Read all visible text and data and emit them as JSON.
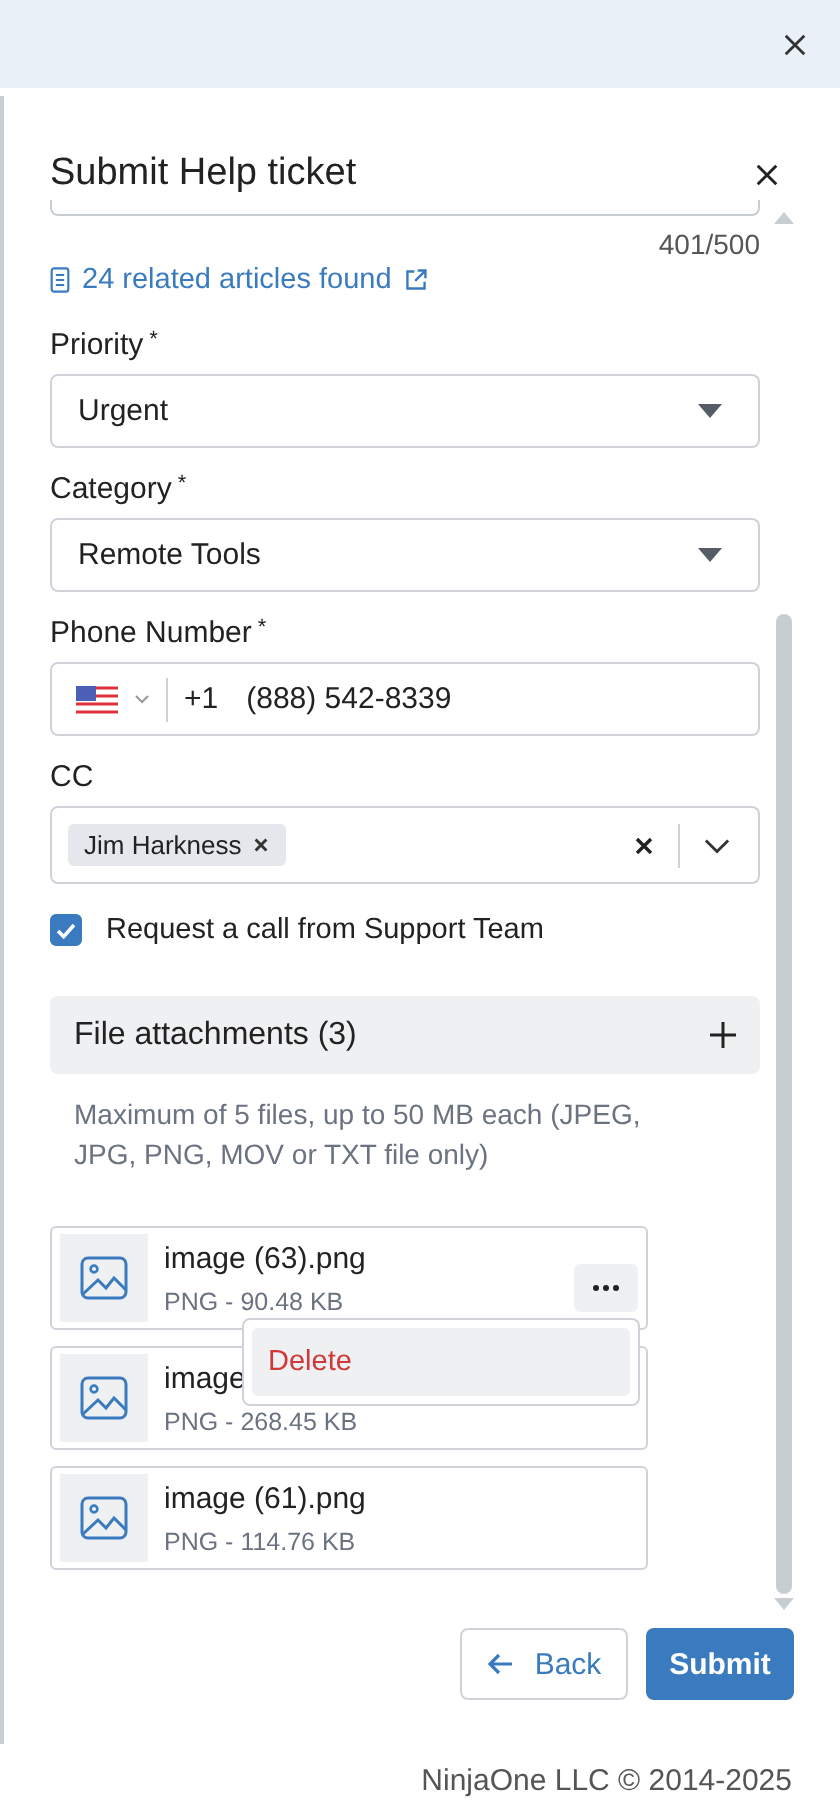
{
  "dialog": {
    "title": "Submit Help ticket",
    "char_count": "401/500",
    "related_link": "24 related articles found"
  },
  "fields": [
    {
      "kind": "select",
      "label": "Priority",
      "required_mark": "*",
      "value": "Urgent"
    },
    {
      "kind": "select",
      "label": "Category",
      "required_mark": "*",
      "value": "Remote Tools"
    },
    {
      "kind": "phone",
      "label": "Phone Number",
      "required_mark": "*",
      "country_code": "+1",
      "value": "(888) 542-8339"
    },
    {
      "kind": "tags",
      "label": "CC",
      "tags": [
        "Jim Harkness"
      ]
    }
  ],
  "request_call": {
    "label": "Request a call from Support Team",
    "checked": true
  },
  "attachments": {
    "title": "File attachments (3)",
    "note": "Maximum of 5 files, up to 50 MB each (JPEG, JPG, PNG, MOV or TXT file only)",
    "files": [
      {
        "name": "image (63).png",
        "meta": "PNG - 90.48 KB",
        "menu_open": true
      },
      {
        "name": "image",
        "meta": "PNG - 268.45 KB",
        "menu_open": false
      },
      {
        "name": "image (61).png",
        "meta": "PNG - 114.76 KB",
        "menu_open": false
      }
    ]
  },
  "file_menu": {
    "items": [
      "Delete"
    ]
  },
  "buttons": {
    "back": "Back",
    "submit": "Submit"
  },
  "footer": "NinjaOne LLC © 2014-2025"
}
